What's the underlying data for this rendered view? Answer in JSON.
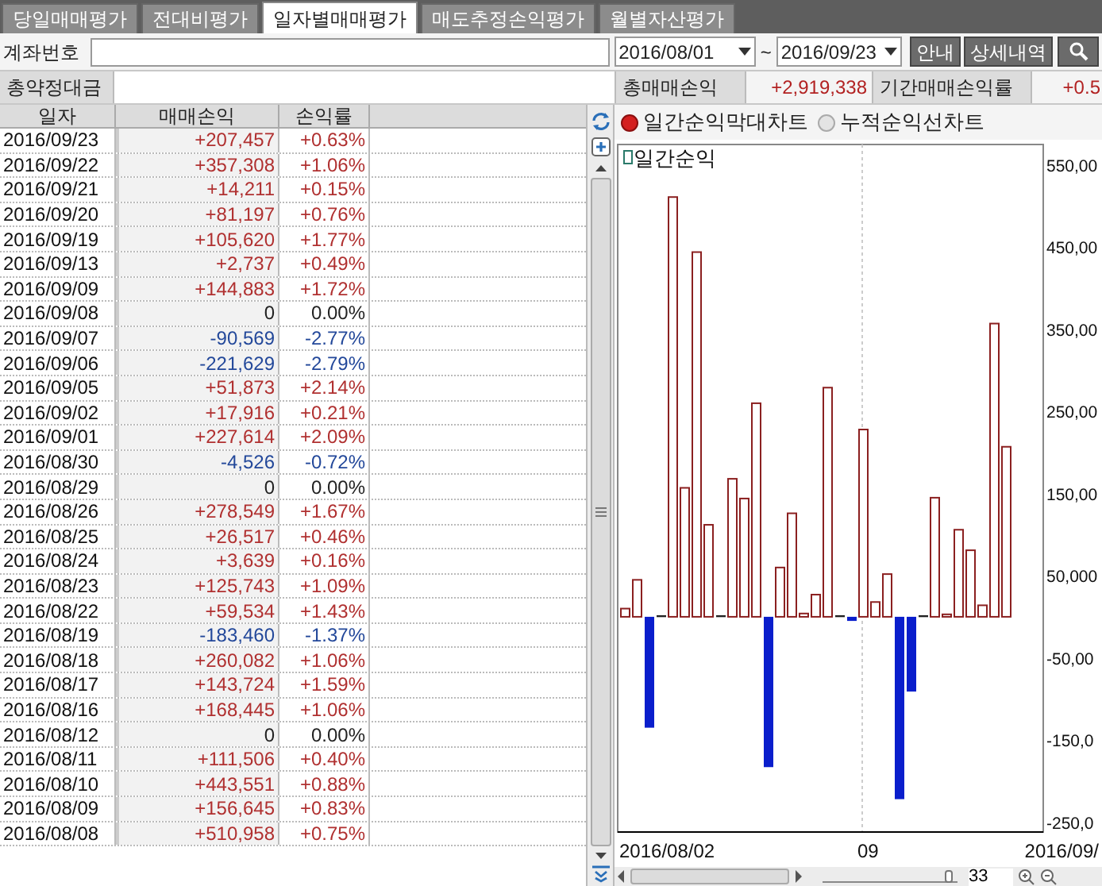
{
  "tabs": [
    {
      "label": "당일매매평가",
      "selected": false
    },
    {
      "label": "전대비평가",
      "selected": false
    },
    {
      "label": "일자별매매평가",
      "selected": true
    },
    {
      "label": "매도추정손익평가",
      "selected": false
    },
    {
      "label": "월별자산평가",
      "selected": false
    }
  ],
  "query": {
    "account_label": "계좌번호",
    "date_from": "2016/08/01",
    "range_sep": "~",
    "date_to": "2016/09/23",
    "buttons": [
      "안내",
      "상세내역"
    ]
  },
  "summary": {
    "contract_label": "총약정대금",
    "pnl_label": "총매매손익",
    "pnl_value": "+2,919,338",
    "rate_label": "기간매매손익률",
    "rate_value": "+0.5"
  },
  "table": {
    "columns": [
      "일자",
      "매매손익",
      "손익률"
    ],
    "rows": [
      {
        "date": "2016/09/23",
        "pnl": "+207,457",
        "rate": "+0.63%",
        "kind": "gain"
      },
      {
        "date": "2016/09/22",
        "pnl": "+357,308",
        "rate": "+1.06%",
        "kind": "gain"
      },
      {
        "date": "2016/09/21",
        "pnl": "+14,211",
        "rate": "+0.15%",
        "kind": "gain"
      },
      {
        "date": "2016/09/20",
        "pnl": "+81,197",
        "rate": "+0.76%",
        "kind": "gain"
      },
      {
        "date": "2016/09/19",
        "pnl": "+105,620",
        "rate": "+1.77%",
        "kind": "gain"
      },
      {
        "date": "2016/09/13",
        "pnl": "+2,737",
        "rate": "+0.49%",
        "kind": "gain"
      },
      {
        "date": "2016/09/09",
        "pnl": "+144,883",
        "rate": "+1.72%",
        "kind": "gain"
      },
      {
        "date": "2016/09/08",
        "pnl": "0",
        "rate": "0.00%",
        "kind": "flat"
      },
      {
        "date": "2016/09/07",
        "pnl": "-90,569",
        "rate": "-2.77%",
        "kind": "loss"
      },
      {
        "date": "2016/09/06",
        "pnl": "-221,629",
        "rate": "-2.79%",
        "kind": "loss"
      },
      {
        "date": "2016/09/05",
        "pnl": "+51,873",
        "rate": "+2.14%",
        "kind": "gain"
      },
      {
        "date": "2016/09/02",
        "pnl": "+17,916",
        "rate": "+0.21%",
        "kind": "gain"
      },
      {
        "date": "2016/09/01",
        "pnl": "+227,614",
        "rate": "+2.09%",
        "kind": "gain"
      },
      {
        "date": "2016/08/30",
        "pnl": "-4,526",
        "rate": "-0.72%",
        "kind": "loss"
      },
      {
        "date": "2016/08/29",
        "pnl": "0",
        "rate": "0.00%",
        "kind": "flat"
      },
      {
        "date": "2016/08/26",
        "pnl": "+278,549",
        "rate": "+1.67%",
        "kind": "gain"
      },
      {
        "date": "2016/08/25",
        "pnl": "+26,517",
        "rate": "+0.46%",
        "kind": "gain"
      },
      {
        "date": "2016/08/24",
        "pnl": "+3,639",
        "rate": "+0.16%",
        "kind": "gain"
      },
      {
        "date": "2016/08/23",
        "pnl": "+125,743",
        "rate": "+1.09%",
        "kind": "gain"
      },
      {
        "date": "2016/08/22",
        "pnl": "+59,534",
        "rate": "+1.43%",
        "kind": "gain"
      },
      {
        "date": "2016/08/19",
        "pnl": "-183,460",
        "rate": "-1.37%",
        "kind": "loss"
      },
      {
        "date": "2016/08/18",
        "pnl": "+260,082",
        "rate": "+1.06%",
        "kind": "gain"
      },
      {
        "date": "2016/08/17",
        "pnl": "+143,724",
        "rate": "+1.59%",
        "kind": "gain"
      },
      {
        "date": "2016/08/16",
        "pnl": "+168,445",
        "rate": "+1.06%",
        "kind": "gain"
      },
      {
        "date": "2016/08/12",
        "pnl": "0",
        "rate": "0.00%",
        "kind": "flat"
      },
      {
        "date": "2016/08/11",
        "pnl": "+111,506",
        "rate": "+0.40%",
        "kind": "gain"
      },
      {
        "date": "2016/08/10",
        "pnl": "+443,551",
        "rate": "+0.88%",
        "kind": "gain"
      },
      {
        "date": "2016/08/09",
        "pnl": "+156,645",
        "rate": "+0.83%",
        "kind": "gain"
      },
      {
        "date": "2016/08/08",
        "pnl": "+510,958",
        "rate": "+0.75%",
        "kind": "gain"
      }
    ]
  },
  "chart_options": [
    {
      "label": "일간순익막대차트",
      "selected": true
    },
    {
      "label": "누적순익선차트",
      "selected": false
    }
  ],
  "chart": {
    "legend": "일간순익",
    "x_labels": [
      "2016/08/02",
      "09",
      "2016/09/"
    ],
    "y_labels": [
      "550,00",
      "450,00",
      "350,00",
      "250,00",
      "150,00",
      "50,000",
      "-50,00",
      "-150,0",
      "-250,0"
    ],
    "zoom": {
      "level": 0.96,
      "value": "33"
    }
  }
}
